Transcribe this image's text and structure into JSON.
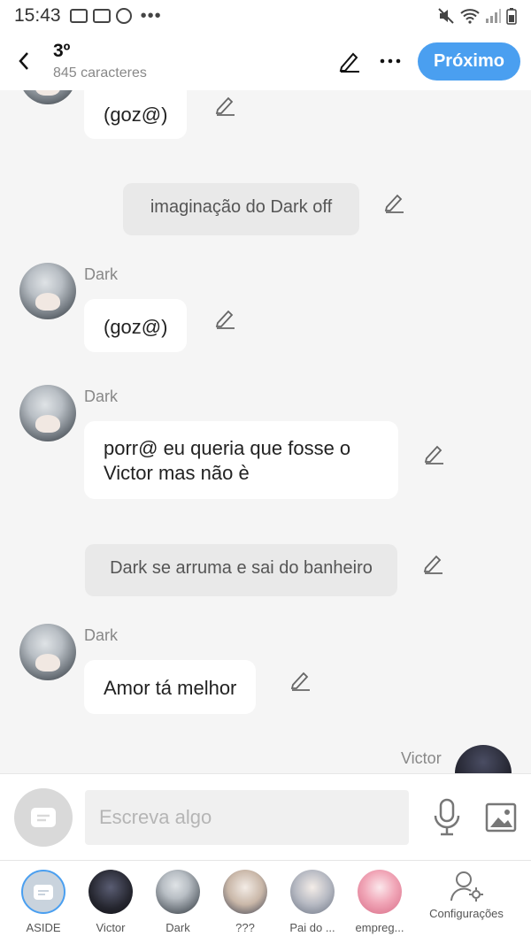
{
  "status_bar": {
    "time": "15:43"
  },
  "header": {
    "title": "3º",
    "subtitle": "845 caracteres",
    "next_label": "Próximo"
  },
  "messages": [
    {
      "type": "bubble",
      "text": "(goz@)"
    },
    {
      "type": "narration",
      "text": "imaginação do Dark off"
    },
    {
      "type": "bubble",
      "sender": "Dark",
      "text": "(goz@)"
    },
    {
      "type": "bubble",
      "sender": "Dark",
      "text": "porr@ eu queria que fosse o Victor mas não è"
    },
    {
      "type": "narration",
      "text": "Dark se arruma e sai do banheiro"
    },
    {
      "type": "bubble",
      "sender": "Dark",
      "text": "Amor tá melhor"
    },
    {
      "type": "partial",
      "sender": "Victor"
    }
  ],
  "input": {
    "placeholder": "Escreva algo"
  },
  "characters": [
    {
      "label": "ASIDE",
      "icon": "chat-icon"
    },
    {
      "label": "Victor"
    },
    {
      "label": "Dark"
    },
    {
      "label": "???"
    },
    {
      "label": "Pai do ..."
    },
    {
      "label": "empreg..."
    },
    {
      "label": "Configurações",
      "icon": "user-settings-icon"
    }
  ],
  "colors": {
    "accent": "#4a9ff0",
    "background": "#f5f5f5"
  }
}
